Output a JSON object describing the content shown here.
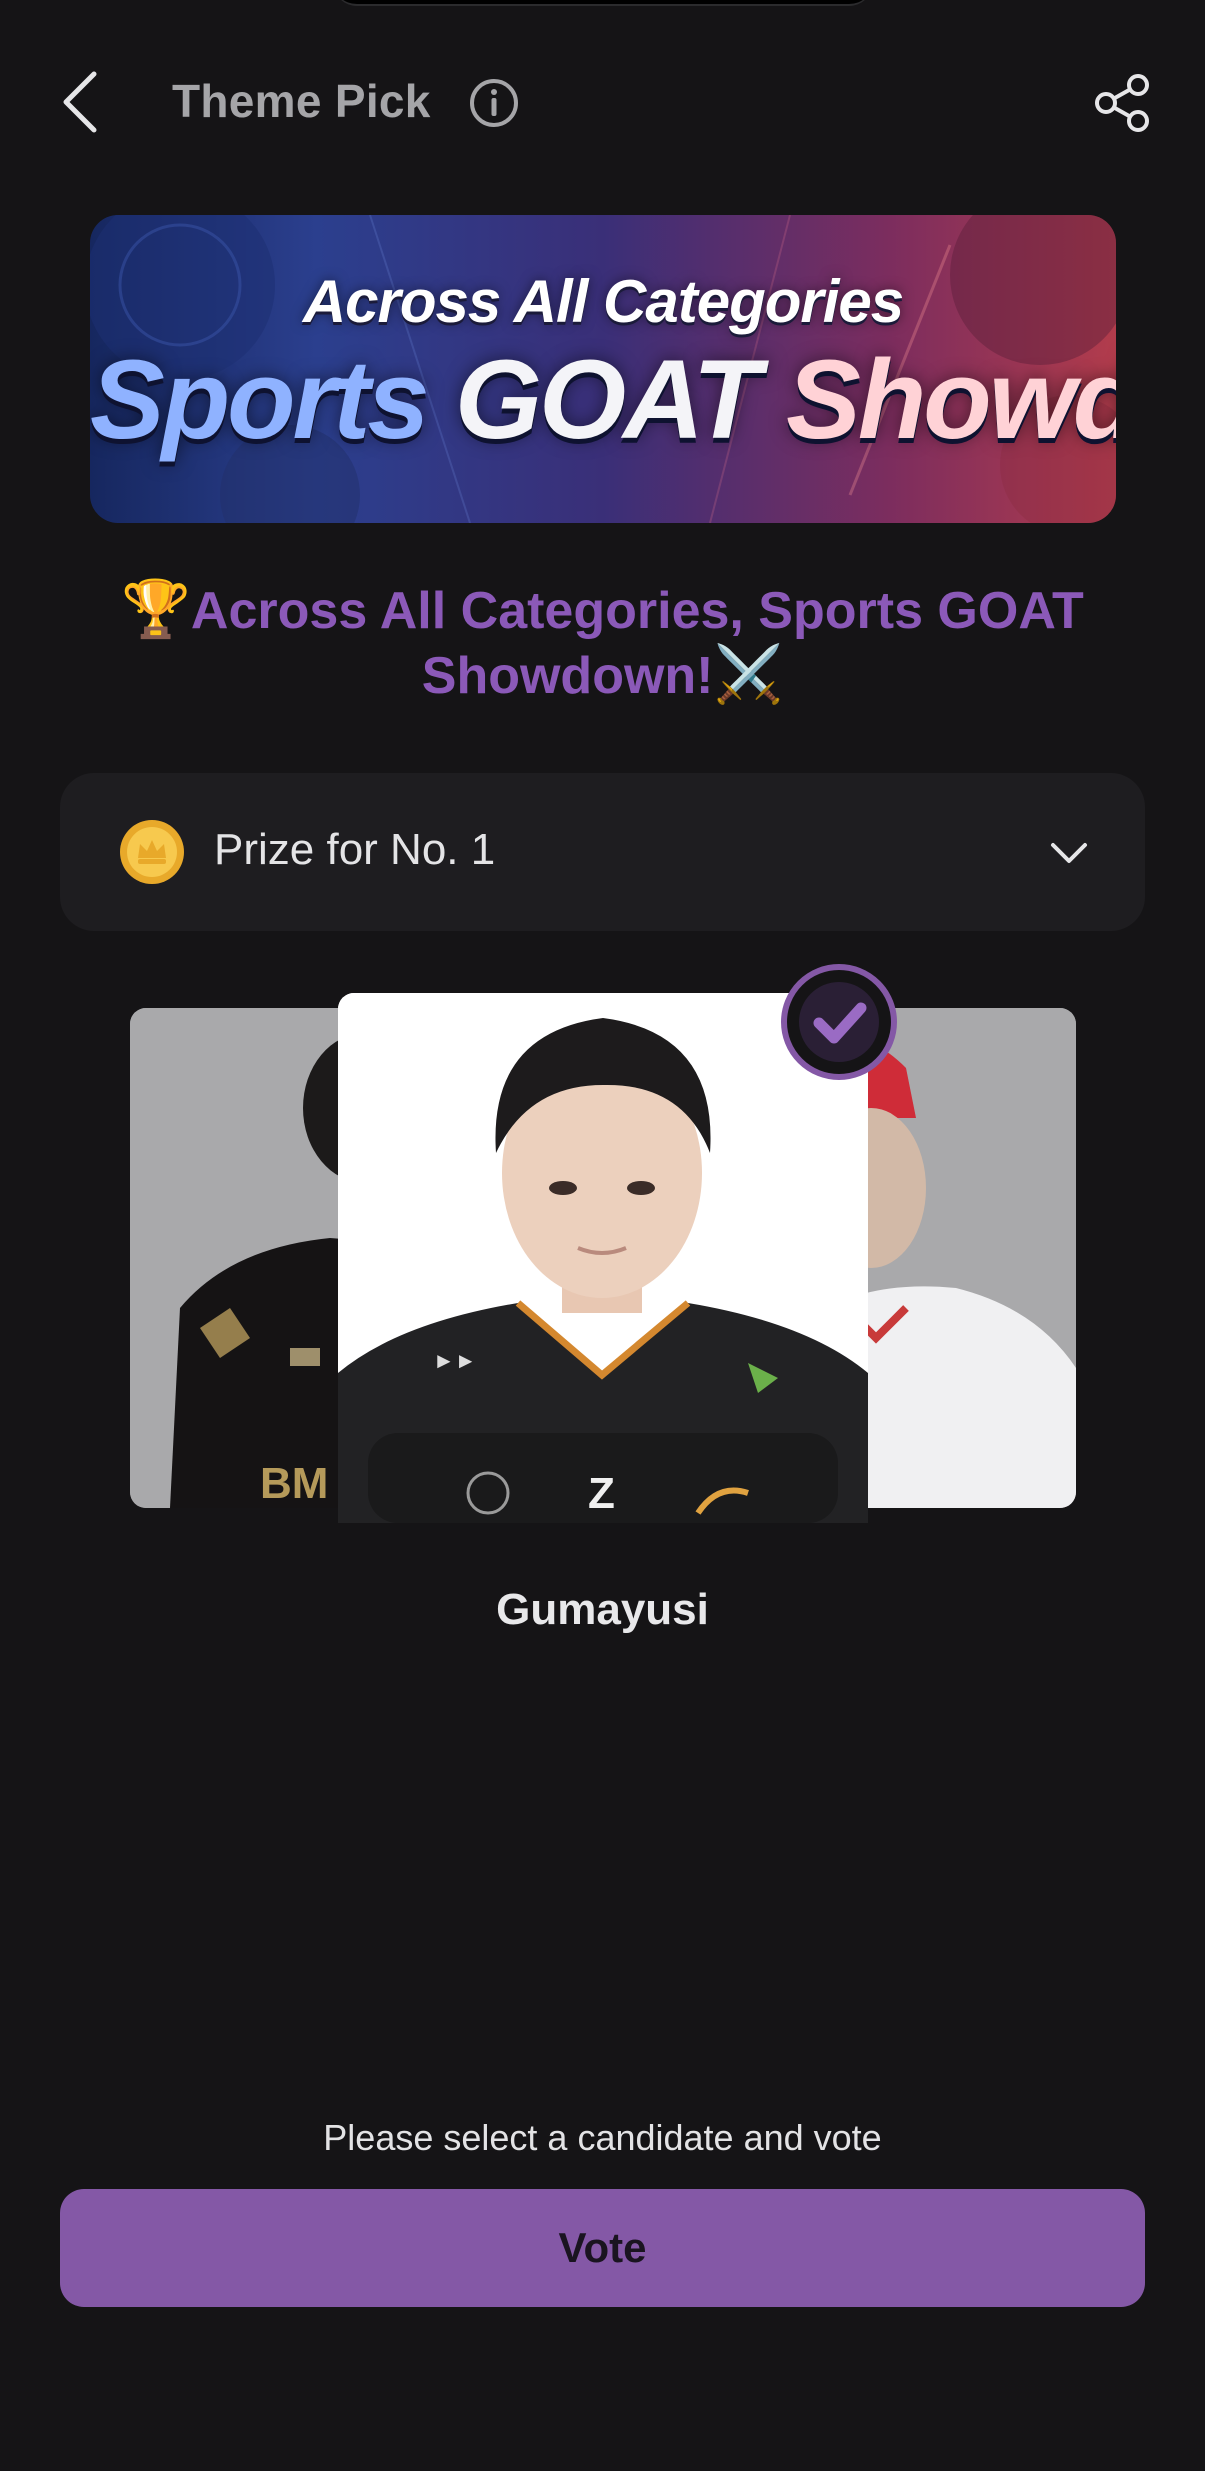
{
  "header": {
    "title": "Theme Pick",
    "back_icon": "chevron-left-icon",
    "info_icon": "info-icon",
    "share_icon": "share-icon"
  },
  "banner": {
    "subtitle": "Across All Categories",
    "title_part1": "Sports",
    "title_part2": "GOAT",
    "title_part3": "Showdown!"
  },
  "headline": {
    "lead_emoji": "🏆",
    "text": "Across All Categories, Sports GOAT Showdown!",
    "trail_emoji": "⚔️"
  },
  "prize": {
    "label": "Prize for No. 1",
    "icon": "coin-icon",
    "expand_icon": "chevron-down-icon"
  },
  "carousel": {
    "selected_candidate": "Gumayusi",
    "selected_icon": "check-icon"
  },
  "footer": {
    "hint": "Please select a candidate and vote",
    "vote_label": "Vote"
  },
  "colors": {
    "background": "#151416",
    "accent": "#8458a6",
    "headline": "#8b59b8",
    "card_panel": "#1e1d20"
  }
}
